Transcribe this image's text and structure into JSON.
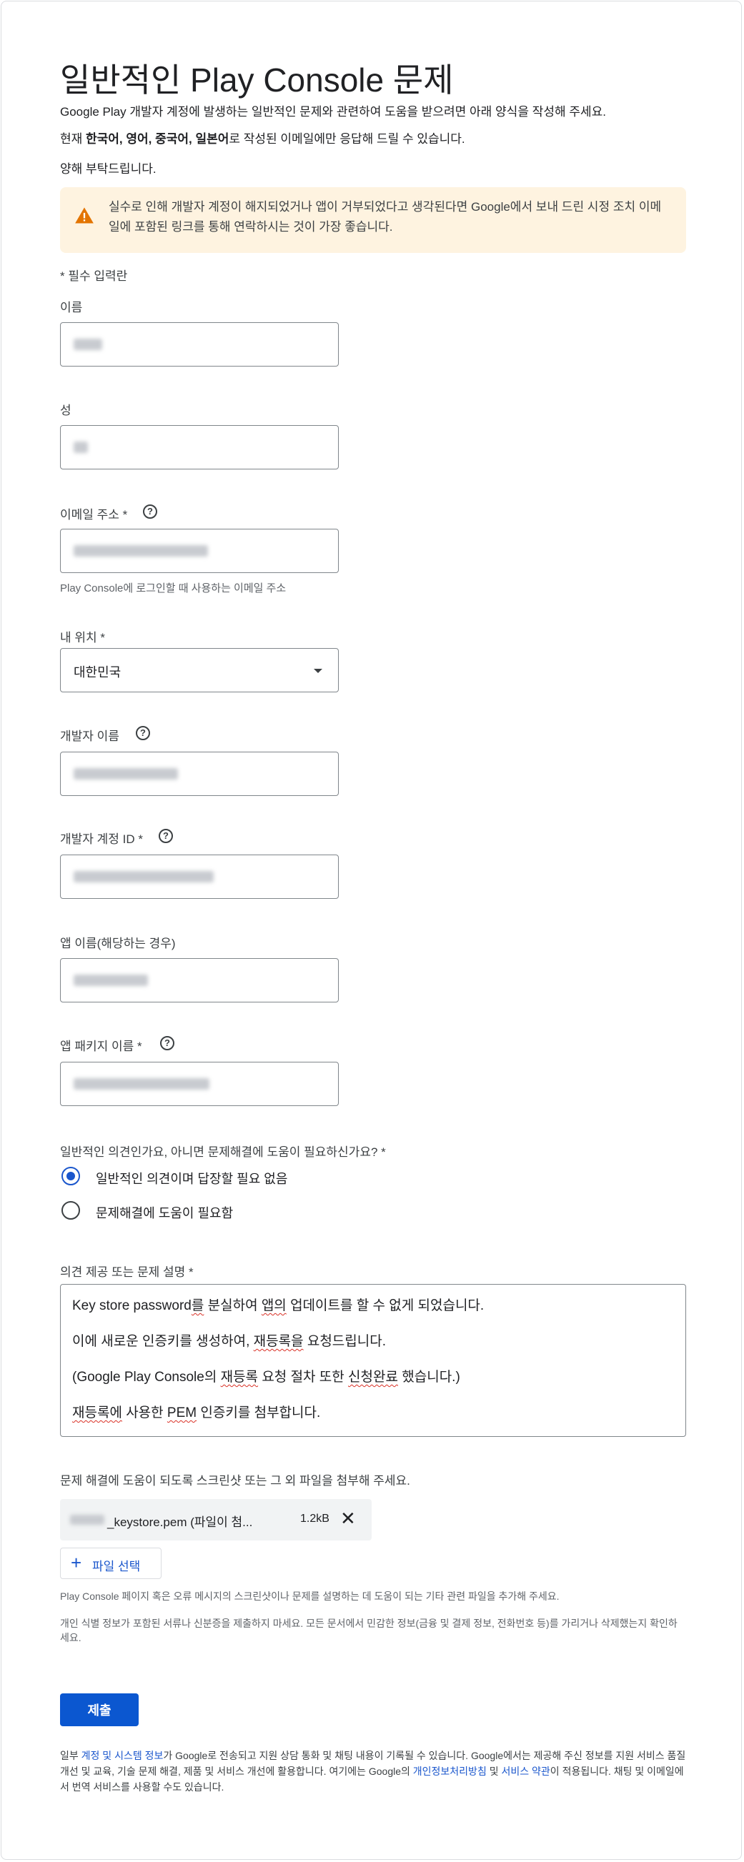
{
  "page": {
    "title": "일반적인 Play Console 문제",
    "intro1": "Google Play 개발자 계정에 발생하는 일반적인 문제와 관련하여 도움을 받으려면 아래 양식을 작성해 주세요.",
    "intro2_prefix": "현재 ",
    "intro2_bold": "한국어, 영어, 중국어, 일본어",
    "intro2_suffix": "로 작성된 이메일에만 응답해 드릴 수 있습니다.",
    "intro3": "양해 부탁드립니다."
  },
  "warning": {
    "icon": "warning-icon",
    "text": "실수로 인해 개발자 계정이 해지되었거나 앱이 거부되었다고 생각된다면 Google에서 보내 드린 시정 조치 이메일에 포함된 링크를 통해 연락하시는 것이 가장 좋습니다."
  },
  "form": {
    "required_note": "* 필수 입력란",
    "first_name_label": "이름",
    "last_name_label": "성",
    "email_label": "이메일 주소 *",
    "email_hint": "Play Console에 로그인할 때 사용하는 이메일 주소",
    "location_label": "내 위치 *",
    "location_value": "대한민국",
    "developer_name_label": "개발자 이름",
    "developer_id_label": "개발자 계정 ID *",
    "app_name_label": "앱 이름(해당하는 경우)",
    "package_label": "앱 패키지 이름 *",
    "question_label": "일반적인 의견인가요, 아니면 문제해결에 도움이 필요하신가요? *",
    "radio_options": [
      "일반적인 의견이며 답장할 필요 없음",
      "문제해결에 도움이 필요함"
    ],
    "description_label": "의견 제공 또는 문제 설명 *",
    "description_lines": [
      "Key store password를 분실하여 앱의 업데이트를 할 수 없게 되었습니다.",
      "이에 새로운 인증키를 생성하여, 재등록을 요청드립니다.",
      "(Google Play Console의 재등록 요청 절차 또한 신청완료 했습니다.)",
      "재등록에 사용한 PEM 인증키를 첨부합니다."
    ],
    "attach_label": "문제 해결에 도움이 되도록 스크린샷 또는 그 외 파일을 첨부해 주세요.",
    "file_name": "_keystore.pem (파일이 첨...",
    "file_size": "1.2kB",
    "file_button": "파일 선택",
    "attach_hint1": "Play Console 페이지 혹은 오류 메시지의 스크린샷이나 문제를 설명하는 데 도움이 되는 기타 관련 파일을 추가해 주세요.",
    "attach_hint2": "개인 식별 정보가 포함된 서류나 신분증을 제출하지 마세요. 모든 문서에서 민감한 정보(금융 및 결제 정보, 전화번호 등)를 가리거나 삭제했는지 확인하세요.",
    "submit": "제출"
  },
  "footer": {
    "p1": "일부 ",
    "link1": "계정 및 시스템 정보",
    "p2": "가 Google로 전송되고 지원 상담 통화 및 채팅 내용이 기록될 수 있습니다. Google에서는 제공해 주신 정보를 지원 서비스 품질 개선 및 교육, 기술 문제 해결, 제품 및 서비스 개선에 활용합니다. 여기에는 Google의 ",
    "link2": "개인정보처리방침",
    "p3": " 및 ",
    "link3": "서비스 약관",
    "p4": "이 적용됩니다. 채팅 및 이메일에서 번역 서비스를 사용할 수도 있습니다."
  },
  "colors": {
    "accent": "#0b57d0",
    "warning_bg": "#fef3e0",
    "warning_icon": "#e37400"
  }
}
